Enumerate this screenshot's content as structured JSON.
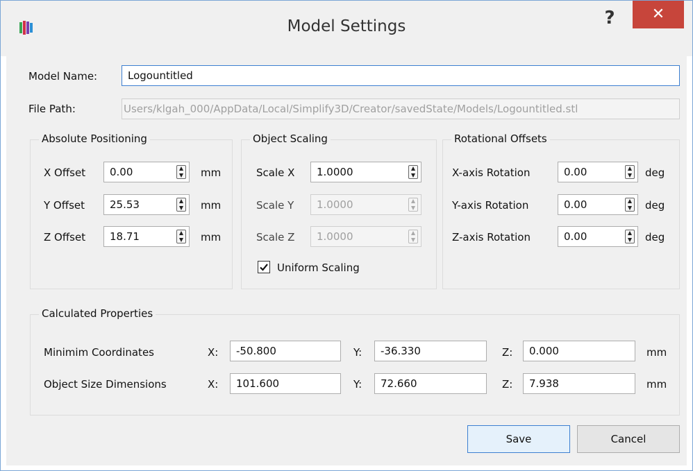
{
  "window": {
    "title": "Model Settings",
    "help_label": "?",
    "close_label": "✕"
  },
  "icons": {
    "app": "model-stack-icon",
    "close": "close-icon",
    "help": "help-icon",
    "checkbox": "checkmark-icon"
  },
  "model_name": {
    "label": "Model Name:",
    "value": "Logountitled"
  },
  "file_path": {
    "label": "File Path:",
    "value": "Users/klgah_000/AppData/Local/Simplify3D/Creator/savedState/Models/Logountitled.stl"
  },
  "absolute_positioning": {
    "title": "Absolute Positioning",
    "unit": "mm",
    "fields": [
      {
        "label": "X Offset",
        "value": "0.00"
      },
      {
        "label": "Y Offset",
        "value": "25.53"
      },
      {
        "label": "Z Offset",
        "value": "18.71"
      }
    ]
  },
  "object_scaling": {
    "title": "Object Scaling",
    "fields": [
      {
        "label": "Scale X",
        "value": "1.0000",
        "enabled": true
      },
      {
        "label": "Scale Y",
        "value": "1.0000",
        "enabled": false
      },
      {
        "label": "Scale Z",
        "value": "1.0000",
        "enabled": false
      }
    ],
    "uniform": {
      "label": "Uniform Scaling",
      "checked": true
    }
  },
  "rotational_offsets": {
    "title": "Rotational Offsets",
    "unit": "deg",
    "fields": [
      {
        "label": "X-axis Rotation",
        "value": "0.00"
      },
      {
        "label": "Y-axis Rotation",
        "value": "0.00"
      },
      {
        "label": "Z-axis Rotation",
        "value": "0.00"
      }
    ]
  },
  "calculated_properties": {
    "title": "Calculated Properties",
    "unit": "mm",
    "axis_x": "X:",
    "axis_y": "Y:",
    "axis_z": "Z:",
    "rows": [
      {
        "label": "Minimim Coordinates",
        "x": "-50.800",
        "y": "-36.330",
        "z": "0.000"
      },
      {
        "label": "Object Size Dimensions",
        "x": "101.600",
        "y": "72.660",
        "z": "7.938"
      }
    ]
  },
  "buttons": {
    "save": "Save",
    "cancel": "Cancel"
  },
  "colors": {
    "close_button": "#c7453b",
    "focus_border": "#3c7fd1",
    "dialog_bg": "#f0f0f0"
  }
}
